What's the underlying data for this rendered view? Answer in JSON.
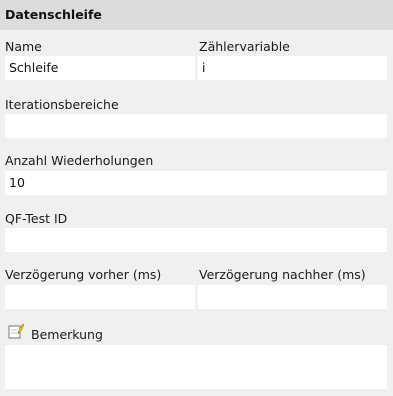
{
  "panel": {
    "title": "Datenschleife"
  },
  "fields": {
    "name": {
      "label": "Name",
      "value": "Schleife"
    },
    "counter": {
      "label": "Zählervariable",
      "value": "i"
    },
    "ranges": {
      "label": "Iterationsbereiche",
      "value": ""
    },
    "repeats": {
      "label": "Anzahl Wiederholungen",
      "value": "10"
    },
    "qfid": {
      "label": "QF-Test ID",
      "value": ""
    },
    "delay_before": {
      "label": "Verzögerung vorher (ms)",
      "value": ""
    },
    "delay_after": {
      "label": "Verzögerung nachher (ms)",
      "value": ""
    },
    "comment": {
      "label": "Bemerkung",
      "value": "",
      "icon": "note-pencil-icon"
    }
  }
}
